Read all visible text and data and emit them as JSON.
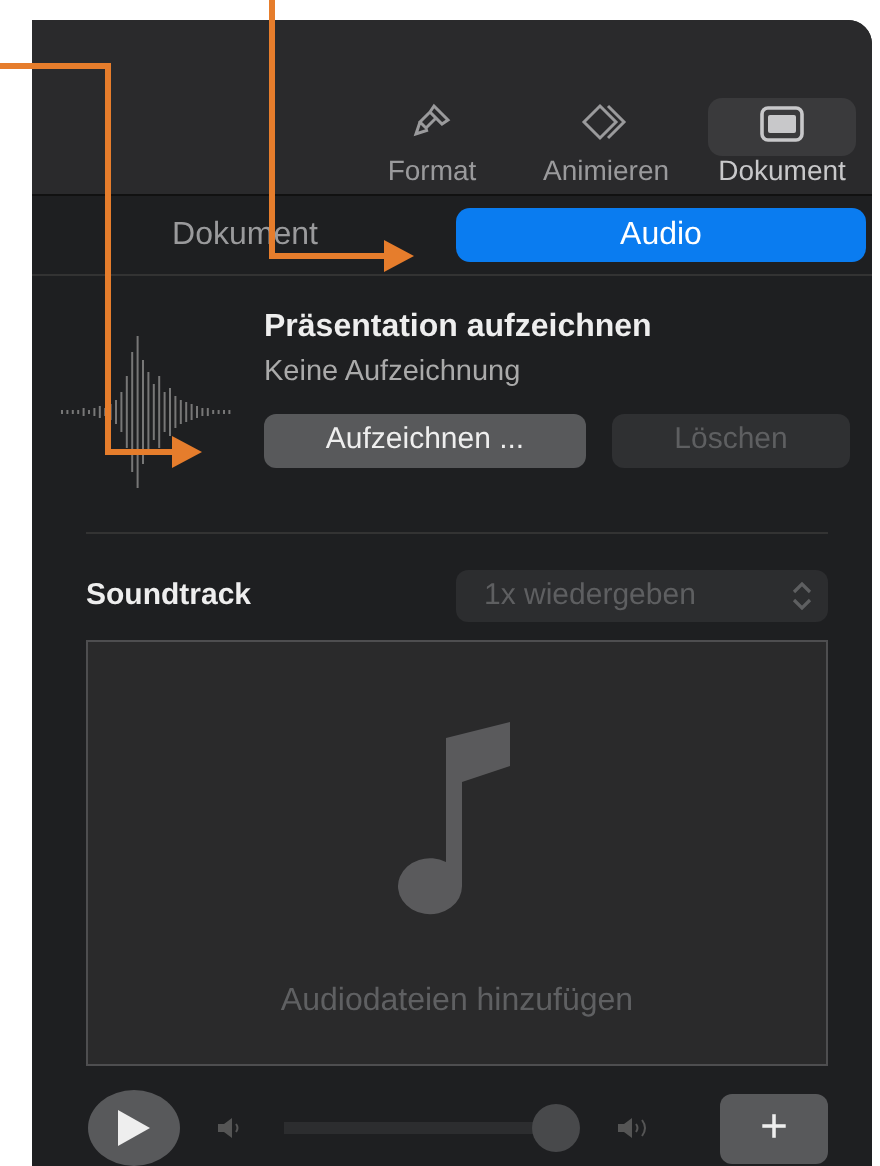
{
  "toolbar": [
    {
      "label": "Format",
      "selected": false
    },
    {
      "label": "Animieren",
      "selected": false
    },
    {
      "label": "Dokument",
      "selected": true
    }
  ],
  "tabs": [
    {
      "label": "Dokument",
      "selected": false
    },
    {
      "label": "Audio",
      "selected": true
    }
  ],
  "recording": {
    "title": "Präsentation aufzeichnen",
    "status": "Keine Aufzeichnung",
    "buttons": [
      {
        "label": "Aufzeichnen ...",
        "disabled": false
      },
      {
        "label": "Löschen",
        "disabled": true
      }
    ]
  },
  "soundtrack": {
    "label": "Soundtrack",
    "mode": {
      "value": "1x wiedergeben",
      "disabled": true
    },
    "drop_hint": "Audiodateien hinzufügen",
    "volume": {
      "level": 0.93
    },
    "add_button": "+"
  }
}
